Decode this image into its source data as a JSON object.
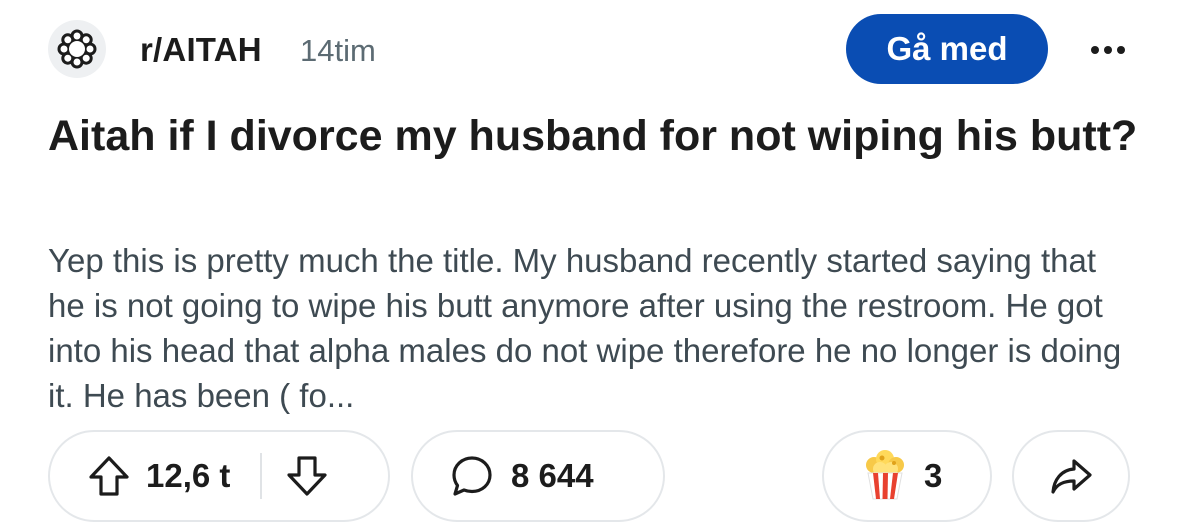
{
  "header": {
    "subreddit": "r/AITAH",
    "time_ago": "14tim",
    "join_label": "Gå med",
    "avatar_icon": "subreddit-flower-icon",
    "more_icon": "more-dots-icon"
  },
  "post": {
    "title": "Aitah if I divorce my husband for not wiping his butt?",
    "body": "Yep this is pretty much the title. My husband recently started saying that he is not going to wipe his butt anymore after using the restroom. He got into his head that alpha males do not wipe therefore he no longer is doing it. He has been ( fo..."
  },
  "actions": {
    "vote_count": "12,6 t",
    "comment_count": "8 644",
    "award_count": "3",
    "upvote_icon": "upvote-arrow-icon",
    "downvote_icon": "downvote-arrow-icon",
    "comment_icon": "comment-bubble-icon",
    "award_icon": "popcorn-icon",
    "share_icon": "share-arrow-icon"
  },
  "colors": {
    "accent": "#0a4db3",
    "text": "#1c1c1c",
    "muted": "#5c6b73",
    "border": "#e4e7ea"
  }
}
